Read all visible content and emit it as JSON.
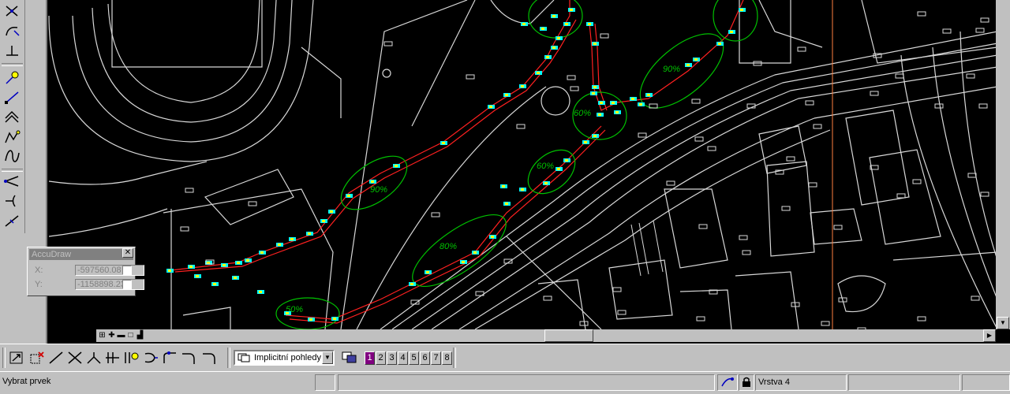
{
  "accudraw": {
    "title": "AccuDraw",
    "x_label": "X:",
    "x_value": "-597560.08",
    "y_label": "Y:",
    "y_value": "-1158898.23",
    "close_label": "✕"
  },
  "view_selector": {
    "value": "Implicitní pohledy"
  },
  "view_numbers": [
    "1",
    "2",
    "3",
    "4",
    "5",
    "6",
    "7",
    "8"
  ],
  "active_view": "1",
  "status": {
    "prompt": "Vybrat prvek",
    "level": "Vrstva 4"
  },
  "map_labels": [
    {
      "text": "90%"
    },
    {
      "text": "60%"
    },
    {
      "text": "60%"
    },
    {
      "text": "90%"
    },
    {
      "text": "80%"
    },
    {
      "text": "50%"
    }
  ],
  "colors": {
    "background": "#000000",
    "linework": "#d8d8d8",
    "route": "#ff2020",
    "zones": "#00c000",
    "markers": "#ffff00",
    "accent": "#800080"
  }
}
